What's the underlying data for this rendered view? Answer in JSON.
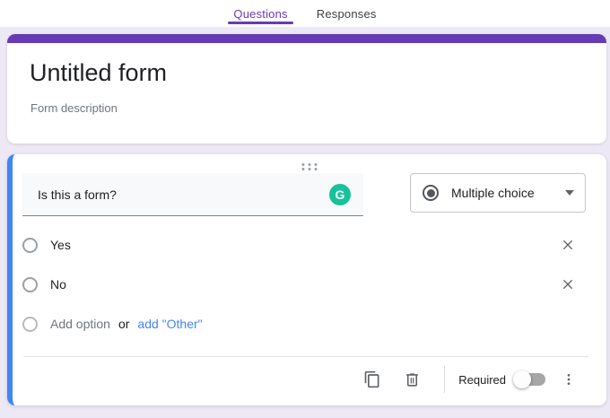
{
  "colors": {
    "purple": "#673ab7",
    "accent_blue": "#4285f4",
    "grammarly_green": "#15c39a",
    "background": "#ece8f5"
  },
  "tab_bar": {
    "tabs": [
      {
        "label": "Questions",
        "active": true
      },
      {
        "label": "Responses",
        "active": false
      }
    ]
  },
  "title_card": {
    "title": "Untitled form",
    "description": "Form description"
  },
  "question_card": {
    "question": {
      "value": "Is this a form?"
    },
    "grammarly_icon": "G",
    "type_dropdown": {
      "selected": "Multiple choice"
    },
    "options": [
      {
        "label": "Yes"
      },
      {
        "label": "No"
      }
    ],
    "add_option_row": {
      "add_option": "Add option",
      "or": "or",
      "add_other": "add \"Other\""
    },
    "footer": {
      "required": "Required",
      "required_on": false
    }
  }
}
